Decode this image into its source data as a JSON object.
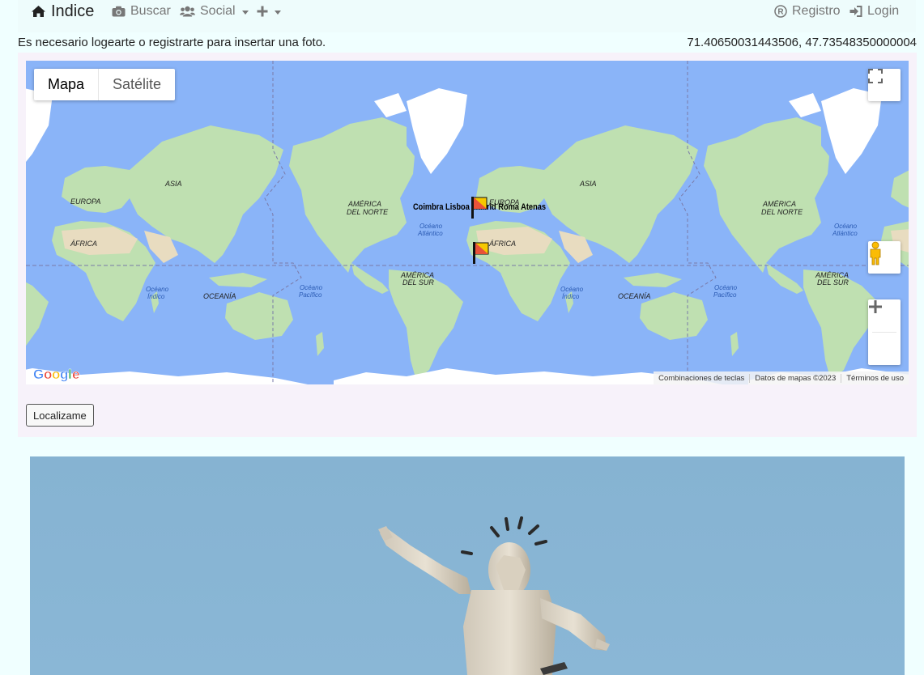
{
  "navbar": {
    "brand": "Indice",
    "search_label": "Buscar",
    "social_label": "Social",
    "register_label": "Registro",
    "login_label": "Login"
  },
  "notice": "Es necesario logearte o registrarte para insertar una foto.",
  "coordinates": "71.40650031443506, 47.73548350000004",
  "map": {
    "type_map": "Mapa",
    "type_satellite": "Satélite",
    "google_logo": "Google",
    "footer_shortcuts": "Combinaciones de teclas",
    "footer_data": "Datos de mapas ©2023",
    "footer_terms": "Términos de uso",
    "labels": {
      "europa_left": "EUROPA",
      "asia_left": "ASIA",
      "africa_left": "ÁFRICA",
      "indico_left_1": "Océano",
      "indico_left_2": "Índico",
      "oceania_left": "OCEANÍA",
      "pacifico_left_1": "Océano",
      "pacifico_left_2": "Pacífico",
      "am_norte_1": "AMÉRICA",
      "am_norte_2": "DEL NORTE",
      "atlantico_1": "Océano",
      "atlantico_2": "Atlántico",
      "europa_mid": "EUROPA",
      "africa_mid": "ÁFRICA",
      "am_sur_1": "AMÉRICA",
      "am_sur_2": "DEL SUR",
      "asia_mid": "ASIA",
      "indico_mid_1": "Océano",
      "indico_mid_2": "Índico",
      "oceania_mid": "OCEANÍA",
      "pacifico_mid_1": "Océano",
      "pacifico_mid_2": "Pacífico",
      "am_norte_r_1": "AMÉRICA",
      "am_norte_r_2": "DEL NORTE",
      "atlantico_r_1": "Océano",
      "atlantico_r_2": "Atlántico",
      "am_sur_r_1": "AMÉRICA",
      "am_sur_r_2": "DEL SUR",
      "marker_overlap_text": "Coimbra Lisboa Madrid Roma Atenas"
    }
  },
  "locate_button": "Localizame",
  "colors": {
    "page_bg": "#f0ffff",
    "ocean": "#8ab4f8",
    "land": "#bfe0b1",
    "panel_bg": "#f7f2fa",
    "sky": "#87b4d3"
  }
}
